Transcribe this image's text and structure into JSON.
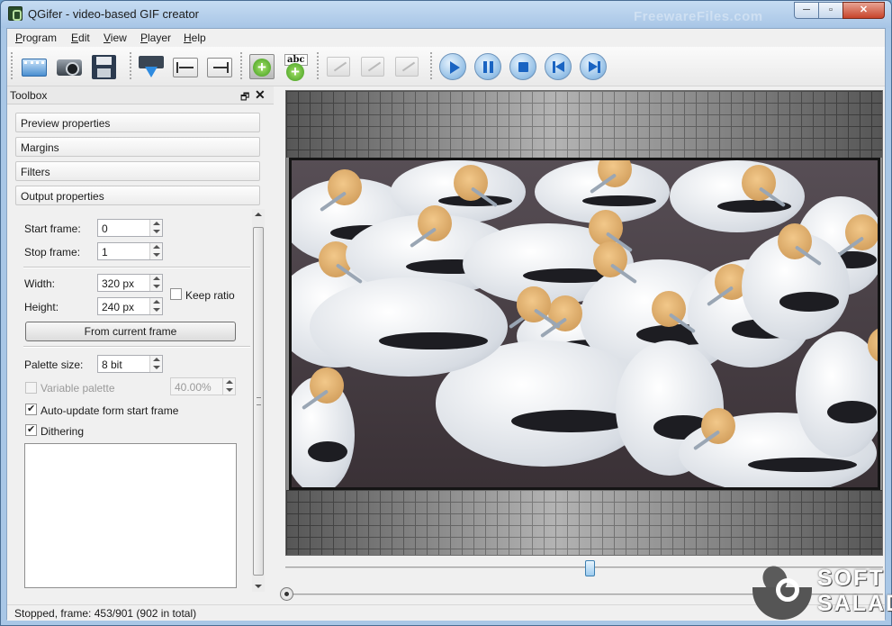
{
  "window": {
    "title": "QGifer - video-based GIF creator",
    "watermark_top": "FreewareFiles.com",
    "buttons": {
      "minimize": "─",
      "maximize": "▫",
      "close": "✕"
    }
  },
  "menu": [
    {
      "label": "Program",
      "key": "P"
    },
    {
      "label": "Edit",
      "key": "E"
    },
    {
      "label": "View",
      "key": "V"
    },
    {
      "label": "Player",
      "key": "P"
    },
    {
      "label": "Help",
      "key": "H"
    }
  ],
  "toolbar": {
    "groups": [
      [
        "open-video-icon",
        "camera-icon",
        "save-icon"
      ],
      [
        "extract-frames-icon",
        "set-start-frame-icon",
        "set-stop-frame-icon"
      ],
      [
        "add-frame-icon",
        "add-text-icon"
      ],
      [
        "edit-disabled-icon",
        "edit-disabled-icon",
        "edit-disabled-icon"
      ],
      [
        "play-icon",
        "pause-icon",
        "stop-icon",
        "previous-frame-icon",
        "next-frame-icon"
      ]
    ],
    "text_icon_label": "abc"
  },
  "toolbox": {
    "title": "Toolbox",
    "float_icon": "🗗",
    "close_icon": "✕",
    "sections": [
      "Preview properties",
      "Margins",
      "Filters",
      "Output properties"
    ],
    "output": {
      "start_frame_label": "Start frame:",
      "start_frame_value": "0",
      "stop_frame_label": "Stop frame:",
      "stop_frame_value": "1",
      "width_label": "Width:",
      "width_value": "320 px",
      "height_label": "Height:",
      "height_value": "240 px",
      "keep_ratio_label": "Keep ratio",
      "keep_ratio_checked": false,
      "from_current_frame_label": "From current frame",
      "palette_size_label": "Palette size:",
      "palette_size_value": "8 bit",
      "variable_palette_label": "Variable palette",
      "variable_palette_checked": false,
      "variable_palette_value": "40.00%",
      "auto_update_label": "Auto-update form start frame",
      "auto_update_checked": true,
      "dithering_label": "Dithering",
      "dithering_checked": true
    }
  },
  "player": {
    "position_fraction": 0.51
  },
  "status": {
    "text": "Stopped, frame: 453/901 (902 in total)"
  },
  "watermark": {
    "line1": "SOFT",
    "line2": "SALAD"
  }
}
